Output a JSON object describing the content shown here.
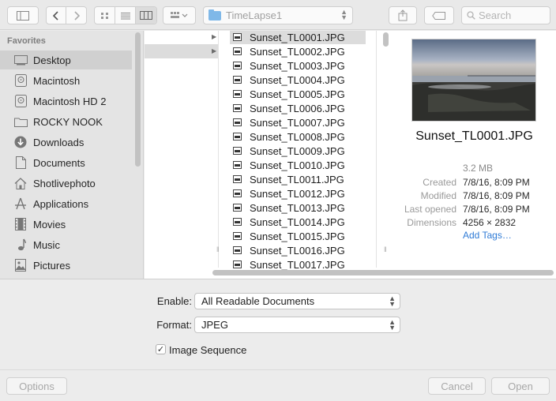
{
  "toolbar": {
    "path_folder": "TimeLapse1",
    "search_placeholder": "Search"
  },
  "sidebar": {
    "heading": "Favorites",
    "items": [
      {
        "label": "Desktop",
        "icon": "desktop-icon"
      },
      {
        "label": "Macintosh",
        "icon": "hard-drive-icon"
      },
      {
        "label": "Macintosh HD 2",
        "icon": "hard-drive-icon"
      },
      {
        "label": "ROCKY NOOK",
        "icon": "folder-icon"
      },
      {
        "label": "Downloads",
        "icon": "downloads-icon"
      },
      {
        "label": "Documents",
        "icon": "documents-icon"
      },
      {
        "label": "Shotlivephoto",
        "icon": "home-icon"
      },
      {
        "label": "Applications",
        "icon": "applications-icon"
      },
      {
        "label": "Movies",
        "icon": "movies-icon"
      },
      {
        "label": "Music",
        "icon": "music-icon"
      },
      {
        "label": "Pictures",
        "icon": "pictures-icon"
      }
    ]
  },
  "files": [
    "Sunset_TL0001.JPG",
    "Sunset_TL0002.JPG",
    "Sunset_TL0003.JPG",
    "Sunset_TL0004.JPG",
    "Sunset_TL0005.JPG",
    "Sunset_TL0006.JPG",
    "Sunset_TL0007.JPG",
    "Sunset_TL0008.JPG",
    "Sunset_TL0009.JPG",
    "Sunset_TL0010.JPG",
    "Sunset_TL0011.JPG",
    "Sunset_TL0012.JPG",
    "Sunset_TL0013.JPG",
    "Sunset_TL0014.JPG",
    "Sunset_TL0015.JPG",
    "Sunset_TL0016.JPG",
    "Sunset_TL0017.JPG"
  ],
  "preview": {
    "filename": "Sunset_TL0001.JPG",
    "size": "3.2 MB",
    "info": [
      {
        "key": "Created",
        "value": "7/8/16, 8:09 PM"
      },
      {
        "key": "Modified",
        "value": "7/8/16, 8:09 PM"
      },
      {
        "key": "Last opened",
        "value": "7/8/16, 8:09 PM"
      },
      {
        "key": "Dimensions",
        "value": "4256 × 2832"
      }
    ],
    "add_tags": "Add Tags…"
  },
  "options": {
    "enable_label": "Enable:",
    "enable_value": "All Readable Documents",
    "format_label": "Format:",
    "format_value": "JPEG",
    "image_sequence_label": "Image Sequence",
    "image_sequence_checked": true
  },
  "buttons": {
    "options": "Options",
    "cancel": "Cancel",
    "open": "Open"
  }
}
